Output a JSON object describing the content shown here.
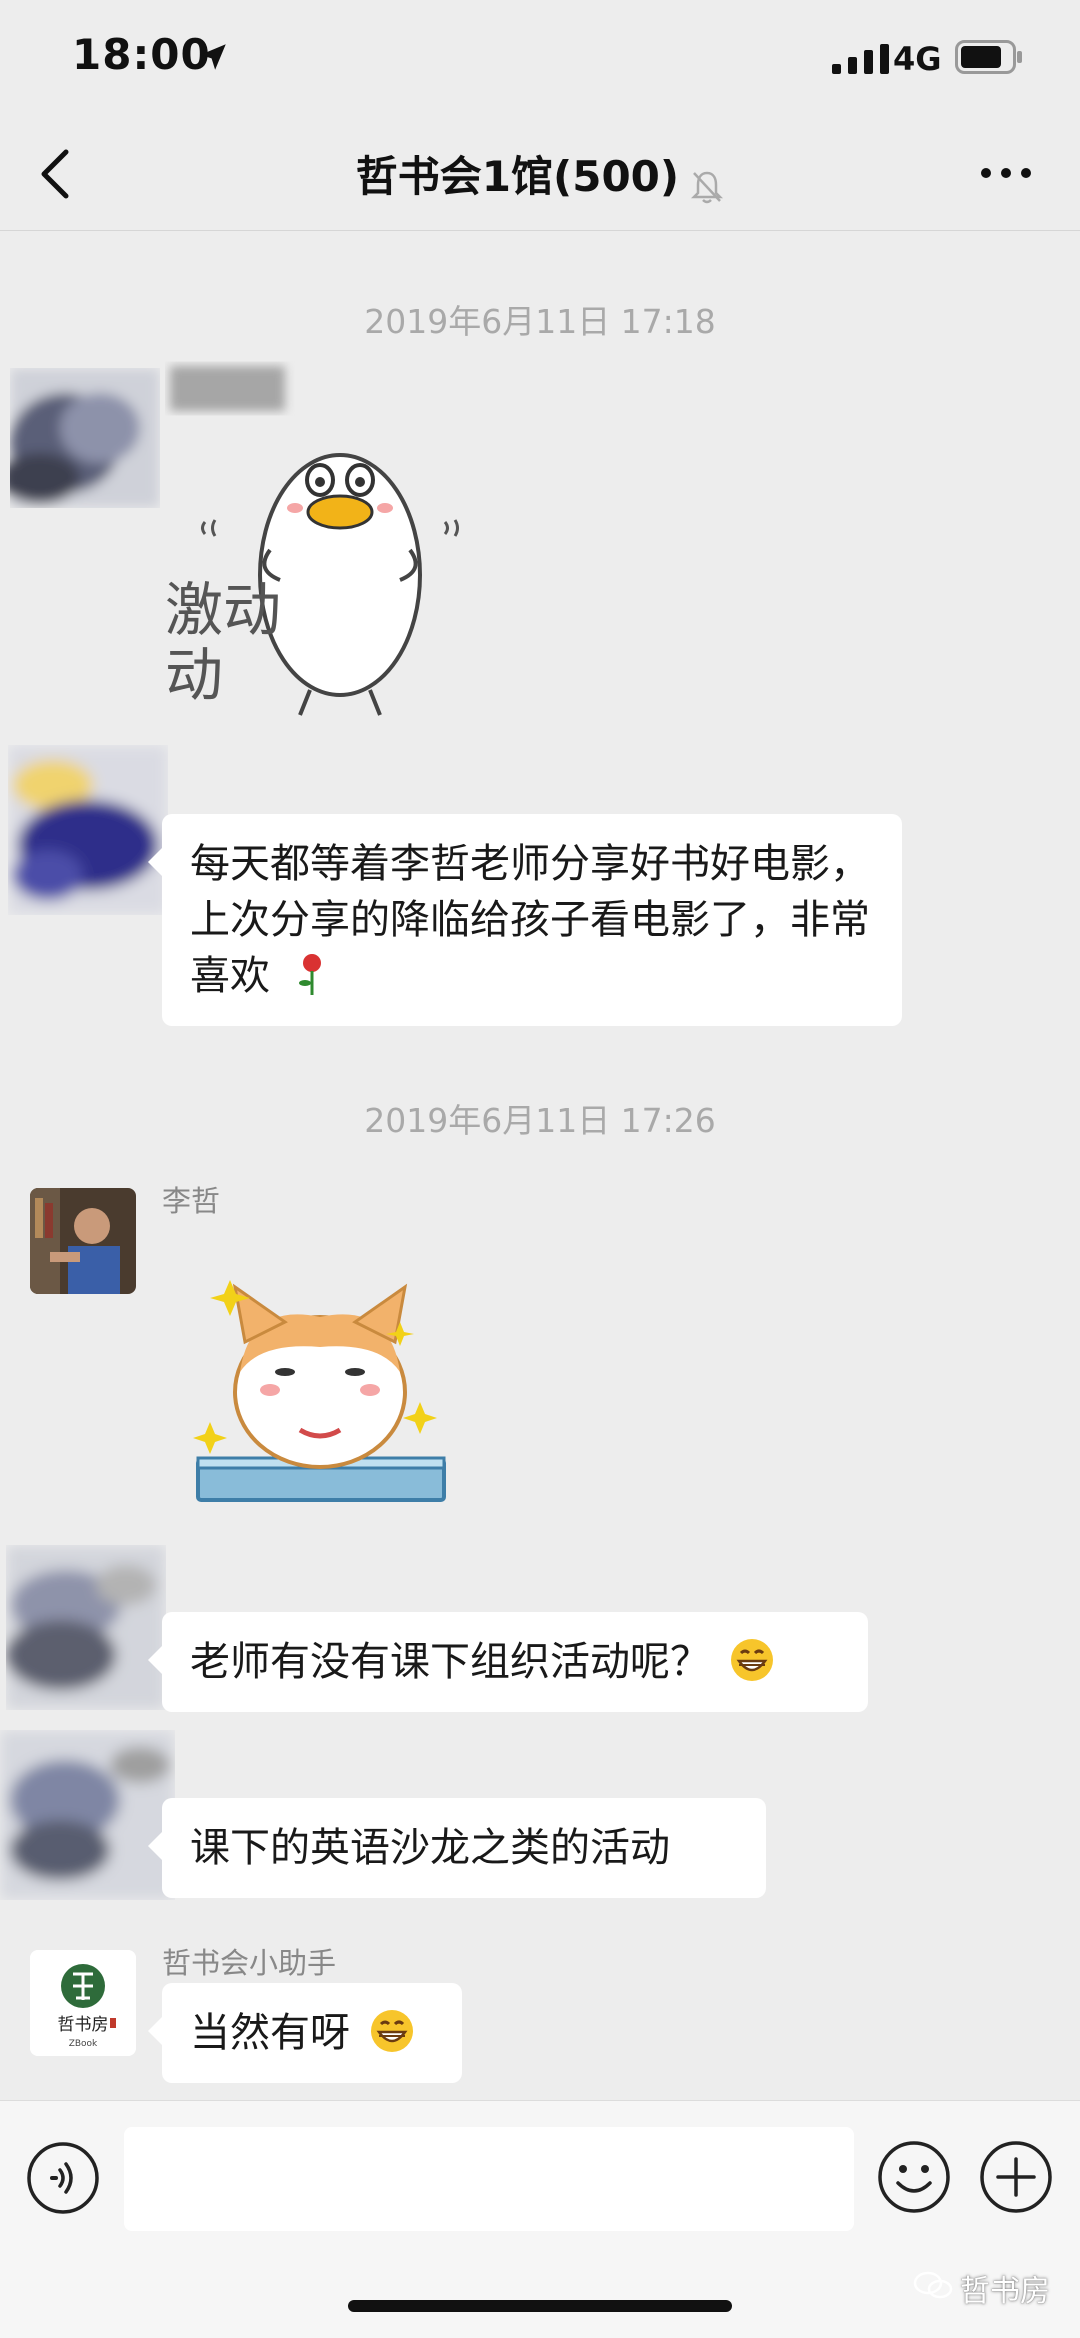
{
  "status_bar": {
    "time": "18:00",
    "network": "4G"
  },
  "nav": {
    "title": "哲书会1馆(500)"
  },
  "messages": {
    "timestamp_1": "2019年6月11日 17:18",
    "sticker_duck_text": "激动",
    "text_1": "每天都等着李哲老师分享好书好电影，上次分享的降临给孩子看电影了，非常喜欢",
    "timestamp_2": "2019年6月11日 17:26",
    "sender_li": "李哲",
    "text_2": "老师有没有课下组织活动呢？",
    "text_3": "课下的英语沙龙之类的活动",
    "sender_assistant": "哲书会小助手",
    "text_4": "当然有呀",
    "assistant_logo_text": "哲书房",
    "assistant_logo_sub": "ZBook"
  },
  "input": {
    "placeholder": ""
  },
  "watermark": "哲书房"
}
